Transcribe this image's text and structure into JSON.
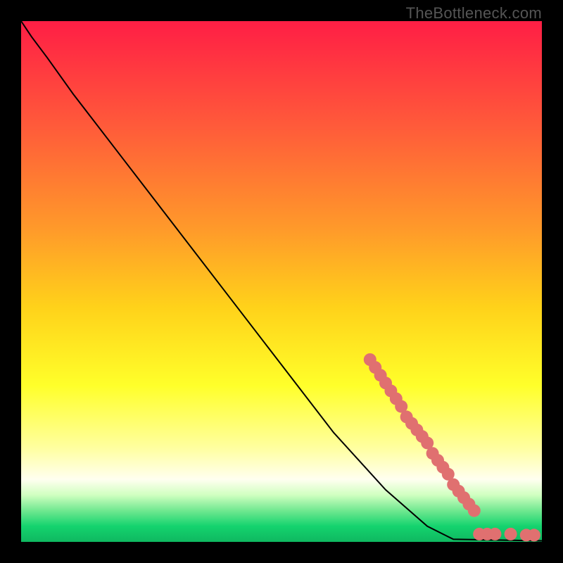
{
  "watermark": "TheBottleneck.com",
  "chart_data": {
    "type": "line",
    "title": "",
    "xlabel": "",
    "ylabel": "",
    "xlim": [
      0,
      100
    ],
    "ylim": [
      0,
      100
    ],
    "background_gradient": {
      "stops": [
        {
          "offset": 0,
          "color": "#ff1e45"
        },
        {
          "offset": 20,
          "color": "#ff5a3a"
        },
        {
          "offset": 40,
          "color": "#ff9a2a"
        },
        {
          "offset": 55,
          "color": "#ffd21a"
        },
        {
          "offset": 70,
          "color": "#ffff2a"
        },
        {
          "offset": 82,
          "color": "#ffffa0"
        },
        {
          "offset": 88,
          "color": "#fffff0"
        },
        {
          "offset": 91,
          "color": "#d0ffc0"
        },
        {
          "offset": 94,
          "color": "#70e890"
        },
        {
          "offset": 97,
          "color": "#14d36e"
        },
        {
          "offset": 100,
          "color": "#0fb860"
        }
      ]
    },
    "curve": [
      {
        "x": 0,
        "y": 100
      },
      {
        "x": 2,
        "y": 97
      },
      {
        "x": 5,
        "y": 93
      },
      {
        "x": 10,
        "y": 86
      },
      {
        "x": 20,
        "y": 73
      },
      {
        "x": 30,
        "y": 60
      },
      {
        "x": 40,
        "y": 47
      },
      {
        "x": 50,
        "y": 34
      },
      {
        "x": 60,
        "y": 21
      },
      {
        "x": 70,
        "y": 10
      },
      {
        "x": 78,
        "y": 3
      },
      {
        "x": 83,
        "y": 0.5
      },
      {
        "x": 100,
        "y": 0.2
      }
    ],
    "dot_clusters": [
      {
        "x_start": 67,
        "x_end": 73,
        "y_start": 35,
        "y_end": 26,
        "count": 7
      },
      {
        "x_start": 74,
        "x_end": 78,
        "y_start": 24,
        "y_end": 19,
        "count": 5
      },
      {
        "x_start": 79,
        "x_end": 82,
        "y_start": 17,
        "y_end": 13,
        "count": 4
      },
      {
        "x_start": 83,
        "x_end": 87,
        "y_start": 11,
        "y_end": 6,
        "count": 5
      }
    ],
    "flat_dots": [
      {
        "x": 88,
        "y": 1.5
      },
      {
        "x": 89.5,
        "y": 1.5
      },
      {
        "x": 91,
        "y": 1.5
      },
      {
        "x": 94,
        "y": 1.5
      },
      {
        "x": 97,
        "y": 1.3
      },
      {
        "x": 98.5,
        "y": 1.3
      }
    ],
    "dot_color": "#e07070",
    "dot_radius": 9
  }
}
